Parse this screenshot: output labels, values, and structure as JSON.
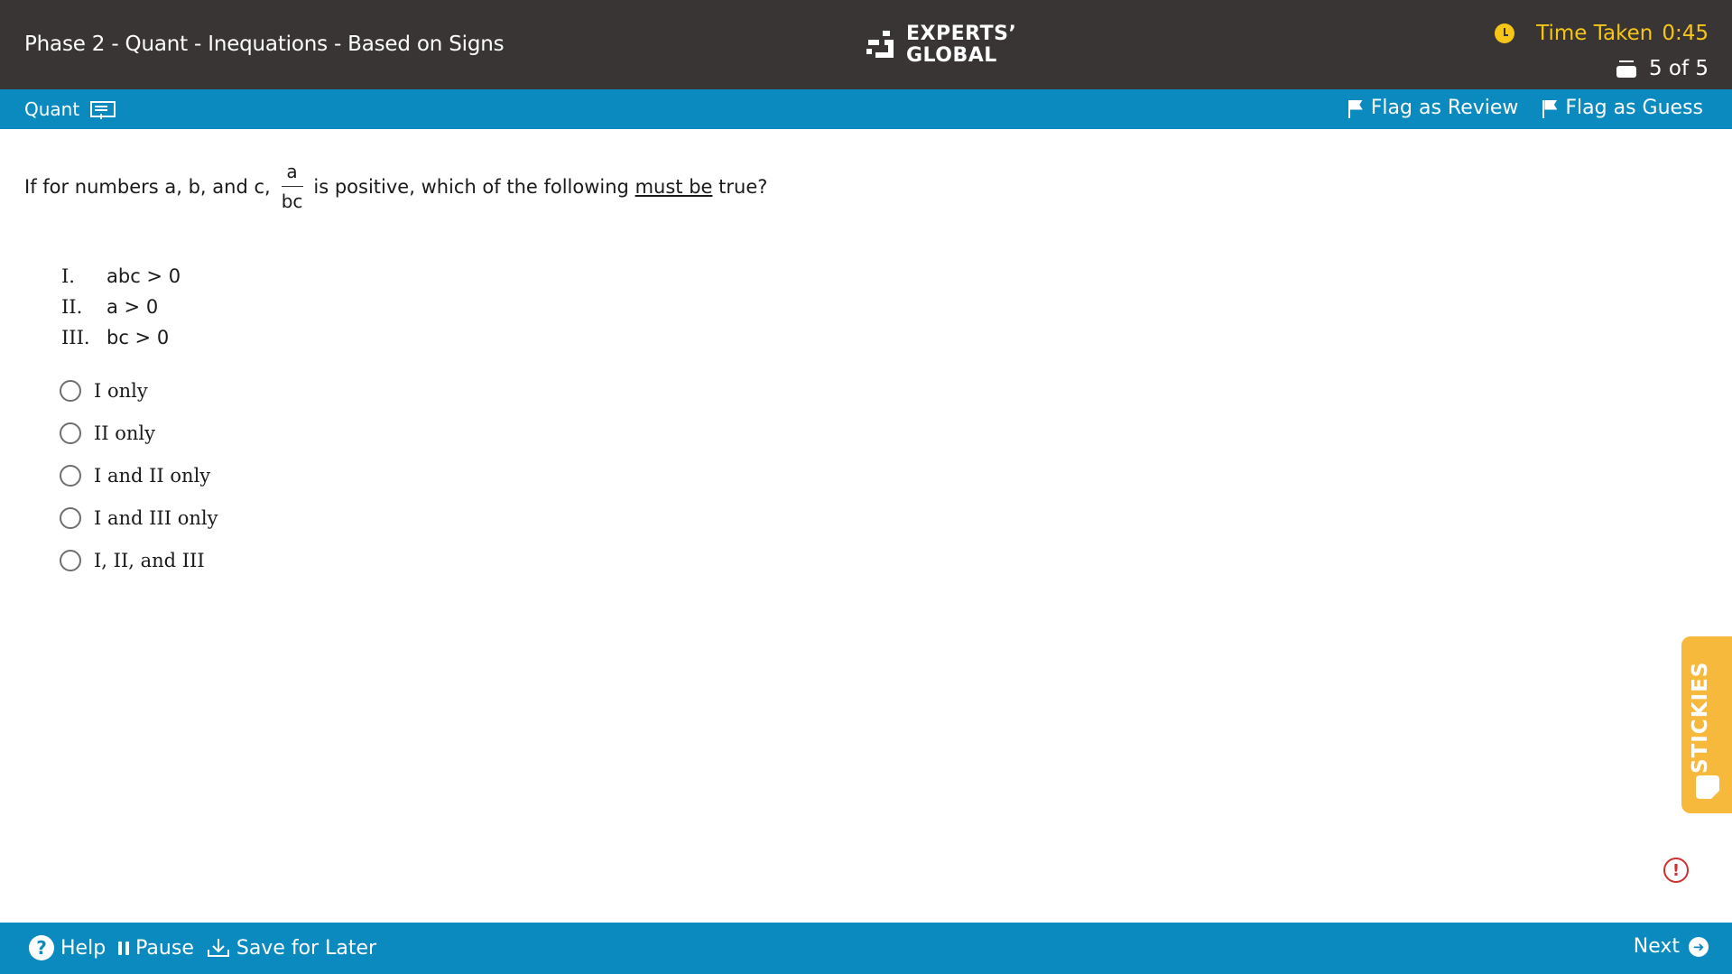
{
  "header": {
    "title": "Phase 2 - Quant - Inequations - Based on Signs",
    "logo_line1": "EXPERTS’",
    "logo_line2": "GLOBAL",
    "timer_label": "Time Taken",
    "timer_value": "0:45",
    "counter": "5 of 5"
  },
  "section_bar": {
    "section": "Quant",
    "flag_review": "Flag as Review",
    "flag_guess": "Flag as Guess"
  },
  "question": {
    "prefix": "If for numbers a, b, and c,",
    "fraction_num": "a",
    "fraction_den": "bc",
    "middle": "is positive, which of the following",
    "emphasis": "must be",
    "suffix": "true?",
    "statements": [
      {
        "roman": "I.",
        "text": "abc > 0"
      },
      {
        "roman": "II.",
        "text": "a > 0"
      },
      {
        "roman": "III.",
        "text": "bc > 0"
      }
    ],
    "options": [
      {
        "label": "I only"
      },
      {
        "label": "II only"
      },
      {
        "label": "I and II only"
      },
      {
        "label": "I and III only"
      },
      {
        "label": "I, II, and III"
      }
    ]
  },
  "stickies": {
    "label": "STICKIES"
  },
  "footer": {
    "help": "Help",
    "pause": "Pause",
    "save_later": "Save for Later",
    "next": "Next"
  },
  "colors": {
    "header_bg": "#3a3535",
    "accent_blue": "#0b8ac0",
    "timer_yellow": "#f5c518",
    "stickies_orange": "#f6b93b",
    "report_red": "#d32f2f"
  }
}
